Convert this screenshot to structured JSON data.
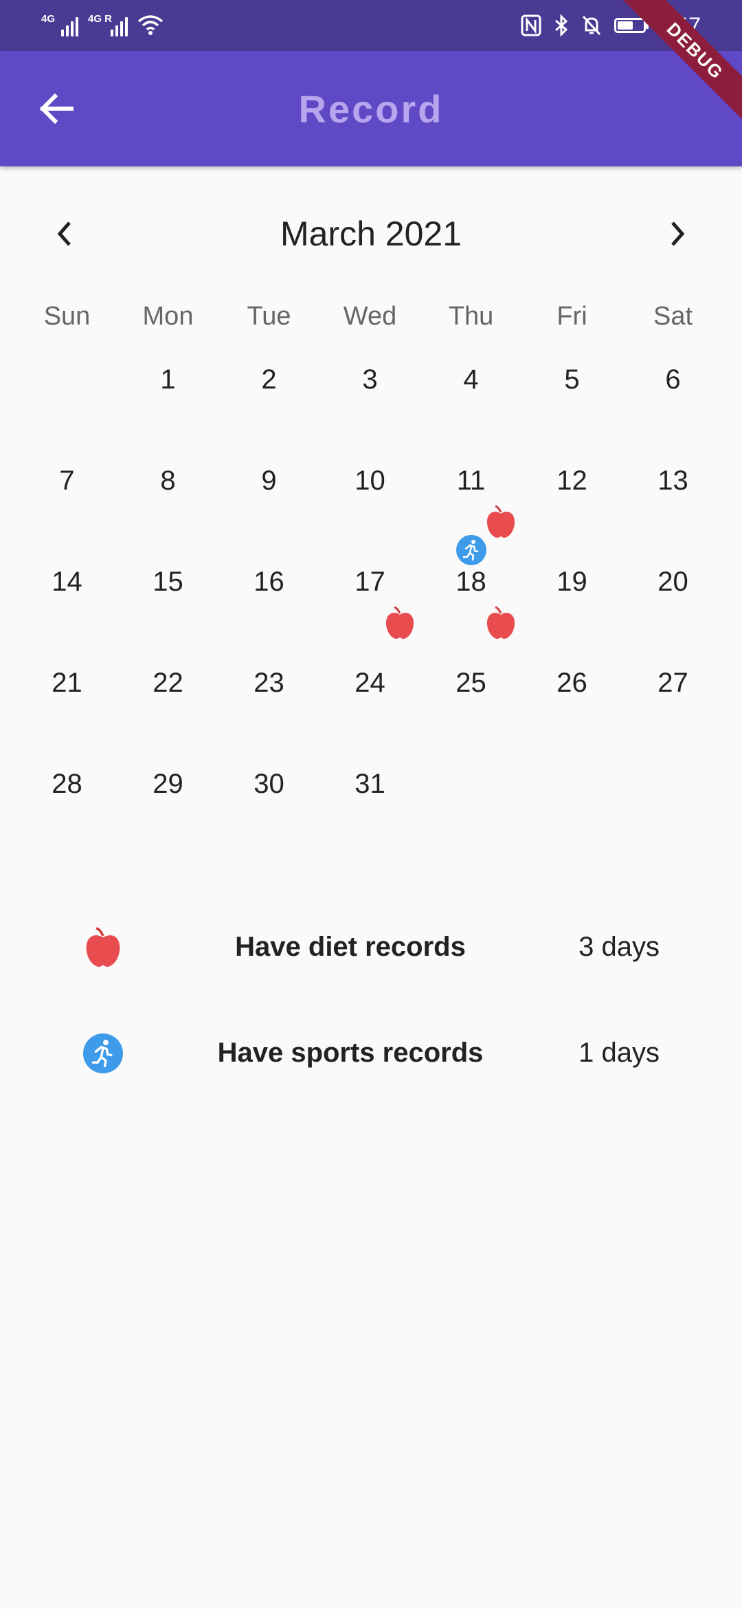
{
  "status_bar": {
    "net1": "4G",
    "net2": "4G R",
    "time": "3:47"
  },
  "app_bar": {
    "title": "Record",
    "debug_banner": "DEBUG"
  },
  "calendar": {
    "month_title": "March 2021",
    "weekdays": [
      "Sun",
      "Mon",
      "Tue",
      "Wed",
      "Thu",
      "Fri",
      "Sat"
    ],
    "first_weekday_index": 1,
    "days_in_month": 31,
    "diet_days": [
      11,
      17,
      18
    ],
    "sport_days": [
      18
    ]
  },
  "legend": {
    "diet_label": "Have diet records",
    "diet_count": "3 days",
    "sport_label": "Have sports records",
    "sport_count": "1 days"
  },
  "colors": {
    "app_bar": "#6049c5",
    "status_bar": "#4a3a94",
    "title": "#b6a6ee",
    "apple": "#e84c4f",
    "sport": "#3d9be9"
  },
  "icons": {
    "back": "arrow-left-icon",
    "prev": "chevron-left-icon",
    "next": "chevron-right-icon",
    "diet": "apple-icon",
    "sport": "running-icon"
  }
}
